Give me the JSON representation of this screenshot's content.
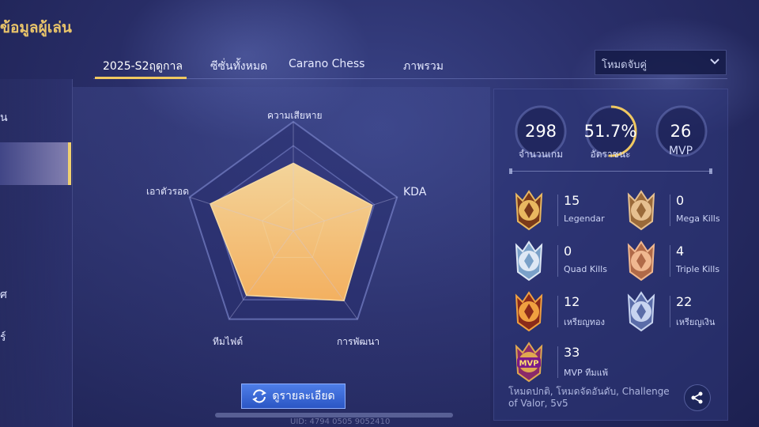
{
  "page_title": "ข้อมูลผู้เล่น",
  "left_items": [
    "น",
    "ศ",
    "ร์"
  ],
  "tabs": [
    {
      "label": "2025-S2ฤดูกาล",
      "active": true
    },
    {
      "label": "ซีซั่นทั้งหมด",
      "active": false
    },
    {
      "label": "Carano Chess",
      "active": false
    },
    {
      "label": "ภาพรวม",
      "active": false
    }
  ],
  "mode_select": {
    "value": "โหมดจับคู่"
  },
  "radar": {
    "axes": [
      "ความเสียหาย",
      "KDA",
      "การพัฒนา",
      "ทีมไฟต์",
      "เอาตัวรอด"
    ],
    "values": [
      0.62,
      0.76,
      0.79,
      0.73,
      0.8
    ]
  },
  "detail_button": {
    "label": "ดูรายละเอียด"
  },
  "uid": "UID: 4794 0505 9052410",
  "stats": {
    "games": {
      "value": "298",
      "label": "จำนวนเกม"
    },
    "win_rate": {
      "value": "51.7%",
      "label": "อัตราชนะ",
      "fraction": 0.517
    },
    "mvp": {
      "value": "26",
      "label": "MVP"
    }
  },
  "medals": [
    {
      "value": "15",
      "label": "Legendar",
      "icon": "legendary-medal-icon"
    },
    {
      "value": "0",
      "label": "Mega Kills",
      "icon": "mega-kills-medal-icon"
    },
    {
      "value": "0",
      "label": "Quad Kills",
      "icon": "quad-kills-medal-icon"
    },
    {
      "value": "4",
      "label": "Triple Kills",
      "icon": "triple-kills-medal-icon"
    },
    {
      "value": "12",
      "label": "เหรียญทอง",
      "icon": "gold-medal-icon"
    },
    {
      "value": "22",
      "label": "เหรียญเงิน",
      "icon": "silver-medal-icon"
    },
    {
      "value": "33",
      "label": "MVP ทีมแพ้",
      "icon": "mvp-lose-medal-icon",
      "badge": "MVP"
    }
  ],
  "modes_text": "โหมดปกติ, โหมดจัดอันดับ, Challenge of Valor, 5v5",
  "colors": {
    "accent_gold": "#f0c860",
    "radar_fill": "#f3b866",
    "button_blue": "#3b6bd8"
  }
}
